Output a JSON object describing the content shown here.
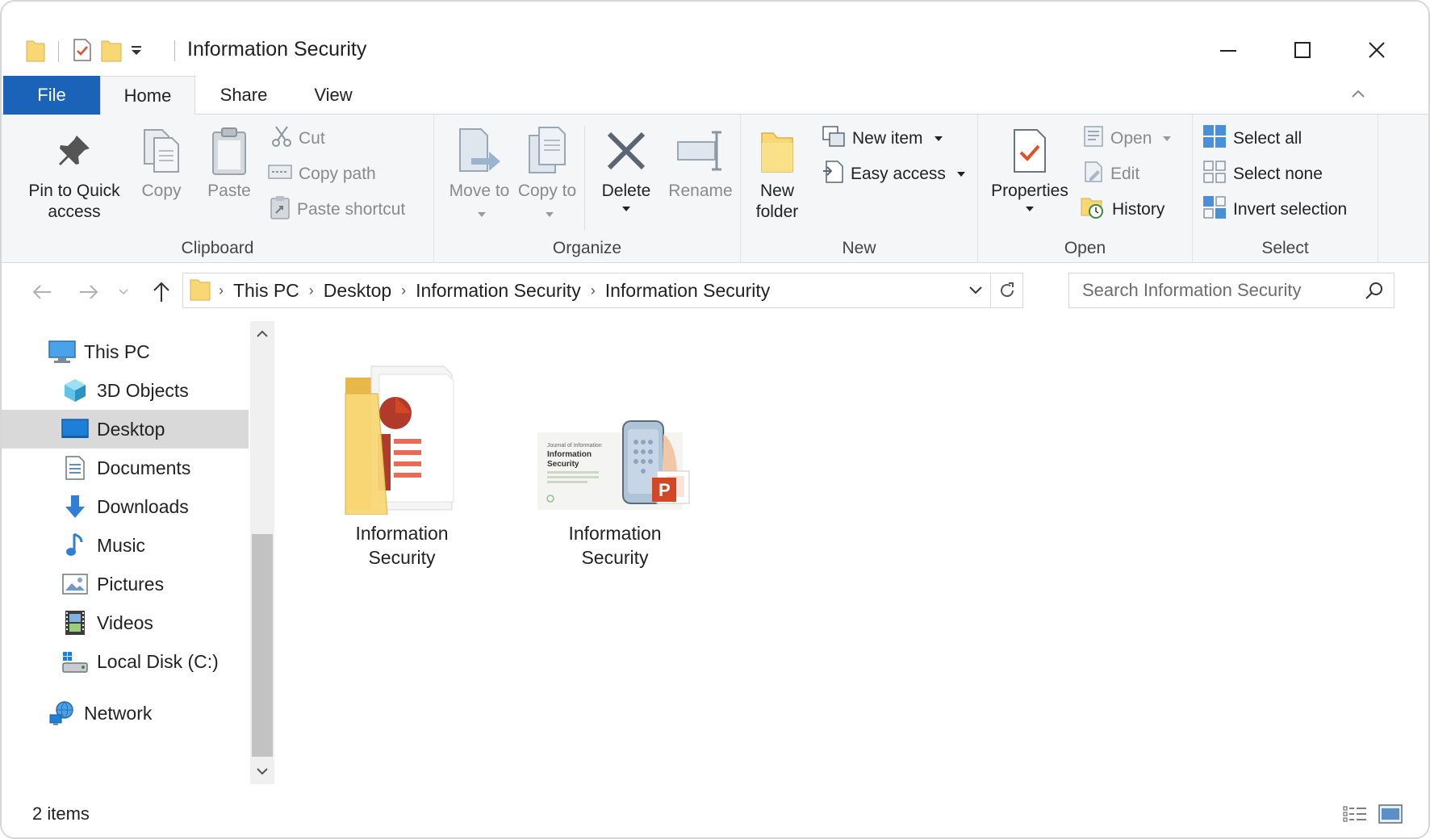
{
  "window": {
    "title": "Information Security"
  },
  "ribbon_tabs": {
    "file": "File",
    "home": "Home",
    "share": "Share",
    "view": "View"
  },
  "clipboard": {
    "label": "Clipboard",
    "pin": "Pin to Quick access",
    "copy": "Copy",
    "paste": "Paste",
    "cut": "Cut",
    "copy_path": "Copy path",
    "paste_shortcut": "Paste shortcut"
  },
  "organize": {
    "label": "Organize",
    "move_to": "Move to",
    "copy_to": "Copy to",
    "delete": "Delete",
    "rename": "Rename"
  },
  "new": {
    "label": "New",
    "new_folder": "New folder",
    "new_item": "New item",
    "easy_access": "Easy access"
  },
  "open": {
    "label": "Open",
    "properties": "Properties",
    "open": "Open",
    "edit": "Edit",
    "history": "History"
  },
  "select": {
    "label": "Select",
    "select_all": "Select all",
    "select_none": "Select none",
    "invert_selection": "Invert selection"
  },
  "address": {
    "crumbs": [
      "This PC",
      "Desktop",
      "Information Security",
      "Information Security"
    ]
  },
  "search": {
    "placeholder": "Search Information Security"
  },
  "nav": {
    "items": [
      {
        "label": "This PC",
        "icon": "computer-icon"
      },
      {
        "label": "3D Objects",
        "icon": "cube-icon"
      },
      {
        "label": "Desktop",
        "icon": "desktop-icon"
      },
      {
        "label": "Documents",
        "icon": "document-icon"
      },
      {
        "label": "Downloads",
        "icon": "download-icon"
      },
      {
        "label": "Music",
        "icon": "music-icon"
      },
      {
        "label": "Pictures",
        "icon": "pictures-icon"
      },
      {
        "label": "Videos",
        "icon": "video-icon"
      },
      {
        "label": "Local Disk (C:)",
        "icon": "disk-icon"
      },
      {
        "label": "Network",
        "icon": "network-icon"
      }
    ]
  },
  "files": [
    {
      "name": "Information Security",
      "type": "folder"
    },
    {
      "name": "Information Security",
      "type": "pptx"
    }
  ],
  "thumbnail": {
    "title_line1": "Information",
    "title_line2": "Security"
  },
  "status": {
    "count": "2 items"
  },
  "colors": {
    "accent": "#1a63b8",
    "folder": "#f8d775",
    "powerpoint": "#d24726",
    "selected_nav": "#d9d9d9"
  }
}
